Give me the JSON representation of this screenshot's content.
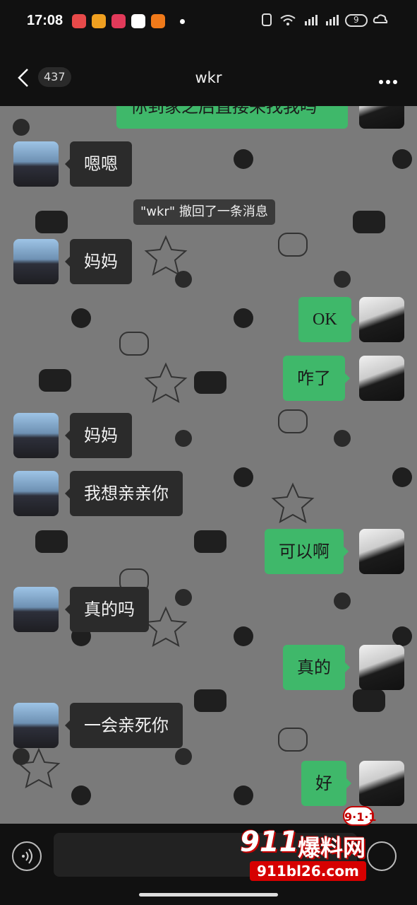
{
  "status_bar": {
    "time": "17:08",
    "battery_level": "9",
    "app_badges": [
      {
        "icon": "music-app-icon",
        "color": "#e84a4a"
      },
      {
        "icon": "video-app-icon",
        "color": "#f0a020"
      },
      {
        "icon": "heart-app-icon",
        "color": "#e23a5a"
      },
      {
        "icon": "plus-app-icon",
        "color": "#ffffff"
      },
      {
        "icon": "grid-app-icon",
        "color": "#f07a1a"
      }
    ]
  },
  "header": {
    "back_count": "437",
    "title": "wkr"
  },
  "messages": {
    "top_partial": "你到家之后直接来找我吗",
    "m1": "嗯嗯",
    "recall_notice": "\"wkr\" 撤回了一条消息",
    "m2": "妈妈",
    "m3": "OK",
    "m4": "咋了",
    "m5": "妈妈",
    "m6": "我想亲亲你",
    "m7": "可以啊",
    "m8": "真的吗",
    "m9": "真的",
    "m10": "一会亲死你",
    "m11": "好"
  },
  "watermark": {
    "number": "911",
    "title": "爆料网",
    "url": "911bl26.com",
    "badge": "9·1·1"
  },
  "colors": {
    "chat_bg": "#7a7a7a",
    "bubble_left": "#2b2b2b",
    "bubble_right": "#3fb86a",
    "bars": "#111111"
  }
}
